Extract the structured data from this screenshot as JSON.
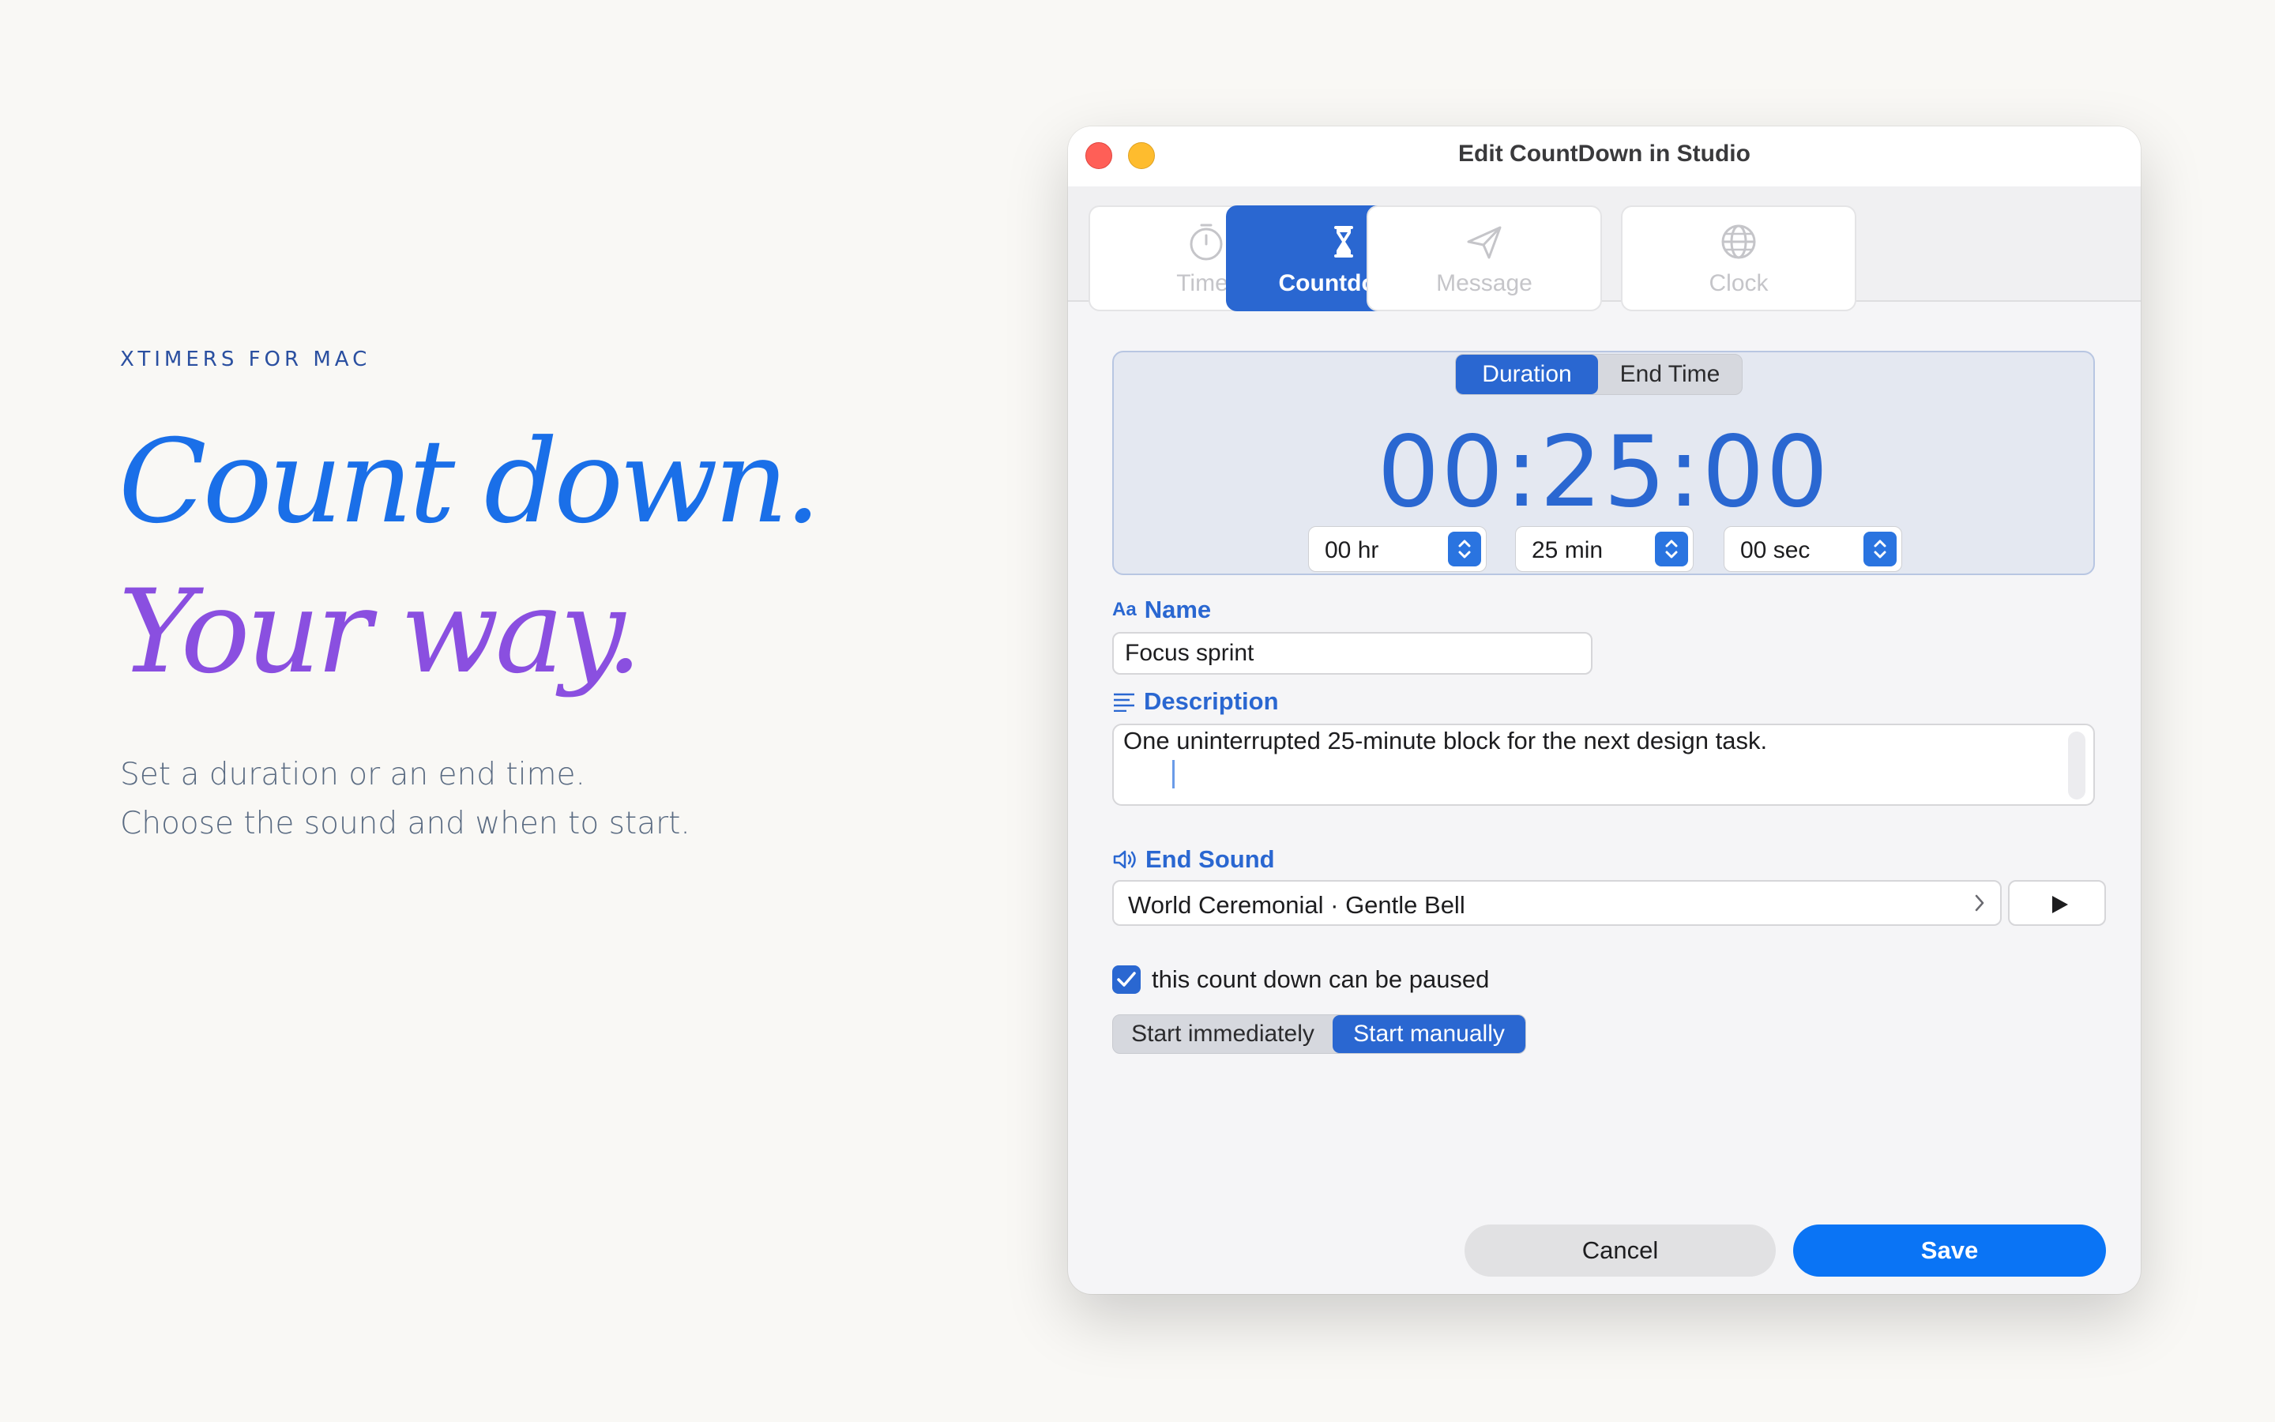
{
  "marketing": {
    "eyebrow": "XTIMERS FOR MAC",
    "headline_line1": "Count down.",
    "headline_line2": "Your way.",
    "subtitle_line1": "Set a duration or an end time.",
    "subtitle_line2": "Choose the sound and when to start."
  },
  "window": {
    "title": "Edit CountDown in Studio"
  },
  "tabs": [
    {
      "label": "Timer",
      "icon": "stopwatch-icon",
      "active": false
    },
    {
      "label": "Countdown",
      "icon": "hourglass-icon",
      "active": true
    },
    {
      "label": "Message",
      "icon": "paper-plane-icon",
      "active": false
    },
    {
      "label": "Clock",
      "icon": "globe-icon",
      "active": false
    }
  ],
  "mode": {
    "options": [
      "Duration",
      "End Time"
    ],
    "selected": "Duration"
  },
  "duration": {
    "display": "00:25:00",
    "hours": "00 hr",
    "minutes": "25 min",
    "seconds": "00 sec"
  },
  "name": {
    "icon_text": "Aa",
    "label": "Name",
    "value": "Focus sprint"
  },
  "description": {
    "label": "Description",
    "value": "One uninterrupted 25-minute block for the next design task."
  },
  "end_sound": {
    "label": "End Sound",
    "value": "World Ceremonial · Gentle Bell"
  },
  "pausable": {
    "label": "this count down can be paused",
    "checked": true
  },
  "start": {
    "options": [
      "Start immediately",
      "Start manually"
    ],
    "selected": "Start manually"
  },
  "actions": {
    "cancel": "Cancel",
    "save": "Save"
  },
  "colors": {
    "accent": "#2a67d1",
    "save": "#0a74f5",
    "headline_blue": "#1a6fe8",
    "headline_purple": "#8a4fe0"
  }
}
